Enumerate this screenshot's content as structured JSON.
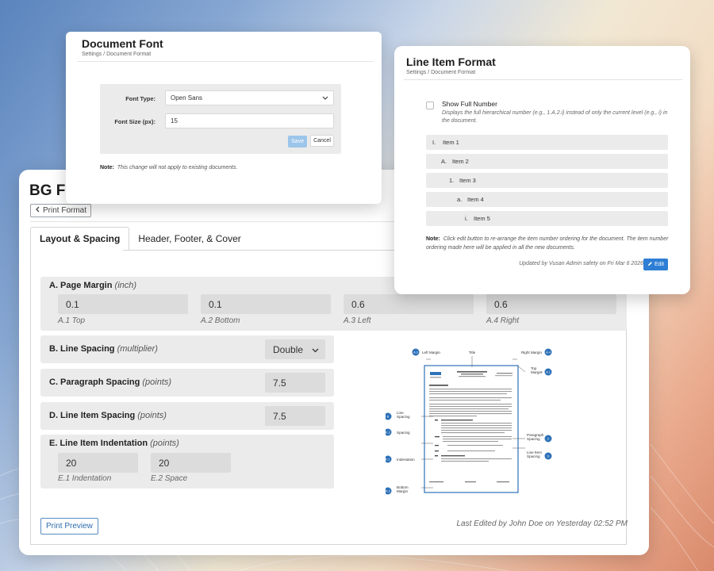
{
  "main": {
    "title": "BG Fo",
    "back_label": "Print Format",
    "tabs": [
      {
        "label": "Layout & Spacing"
      },
      {
        "label": "Header, Footer, & Cover"
      }
    ],
    "page_margin": {
      "title": "A. Page Margin",
      "unit": "(inch)",
      "fields": [
        {
          "value": "0.1",
          "label": "A.1 Top"
        },
        {
          "value": "0.1",
          "label": "A.2 Bottom"
        },
        {
          "value": "0.6",
          "label": "A.3 Left"
        },
        {
          "value": "0.6",
          "label": "A.4 Right"
        }
      ]
    },
    "line_spacing": {
      "title": "B. Line Spacing",
      "unit": "(multiplier)",
      "value": "Double"
    },
    "paragraph_spacing": {
      "title": "C. Paragraph Spacing",
      "unit": "(points)",
      "value": "7.5"
    },
    "line_item_spacing": {
      "title": "D. Line Item Spacing",
      "unit": "(points)",
      "value": "7.5"
    },
    "line_item_indentation": {
      "title": "E. Line Item Indentation",
      "unit": "(points)",
      "fields": [
        {
          "value": "20",
          "label": "E.1 Indentation"
        },
        {
          "value": "20",
          "label": "E.2 Space"
        }
      ]
    },
    "print_preview_label": "Print Preview",
    "last_edited": "Last Edited by John Doe on Yesterday 02:52 PM",
    "diagram": {
      "labels": {
        "left_margin": "Left Margin",
        "title": "Title",
        "right_margin": "Right Margin",
        "top_margin": "Top Margin",
        "line_spacing": "Line Spacing",
        "spacing": "Spacing",
        "indentation": "Indentation",
        "paragraph_spacing": "Paragraph Spacing",
        "line_item_spacing": "Line Item Spacing",
        "bottom_margin": "Bottom Margin"
      },
      "badges": {
        "left_margin": "A.3",
        "right_margin": "A.4",
        "top_margin": "A.1",
        "line_spacing": "B",
        "spacing": "E.2",
        "indentation": "E.1",
        "paragraph_spacing": "C",
        "line_item_spacing": "D",
        "bottom_margin": "A.2"
      }
    }
  },
  "document_font": {
    "title": "Document Font",
    "breadcrumb": "Settings / Document Format",
    "font_type_label": "Font Type:",
    "font_type_value": "Open Sans",
    "font_size_label": "Font Size (px):",
    "font_size_value": "15",
    "save_label": "Save",
    "cancel_label": "Cancel",
    "note_label": "Note:",
    "note_text": "This change will not apply to existing documents."
  },
  "line_item_format": {
    "title": "Line Item Format",
    "breadcrumb": "Settings / Document Format",
    "show_full_label": "Show Full Number",
    "show_full_desc": "Displays the full hierarchical number (e.g., 1.A.2.i) instead of only the current level (e.g., i) in the document.",
    "items": [
      {
        "marker": "I.",
        "label": "Item 1"
      },
      {
        "marker": "A.",
        "label": "Item 2"
      },
      {
        "marker": "1.",
        "label": "Item 3"
      },
      {
        "marker": "a.",
        "label": "Item 4"
      },
      {
        "marker": "i.",
        "label": "Item 5"
      }
    ],
    "note_label": "Note:",
    "note_text": "Click edit button to re-arrange the item number ordering for the document. The item number ordering made here will be applied in all the new documents.",
    "updated_text": "Updated by Vusan Admin safety on Fri Mar 6 2026",
    "edit_label": "Edit"
  },
  "colors": {
    "accent": "#2d7ed4",
    "section_bg": "#ebebeb",
    "field_bg": "#dcdcdc",
    "badge": "#2f72b8"
  }
}
